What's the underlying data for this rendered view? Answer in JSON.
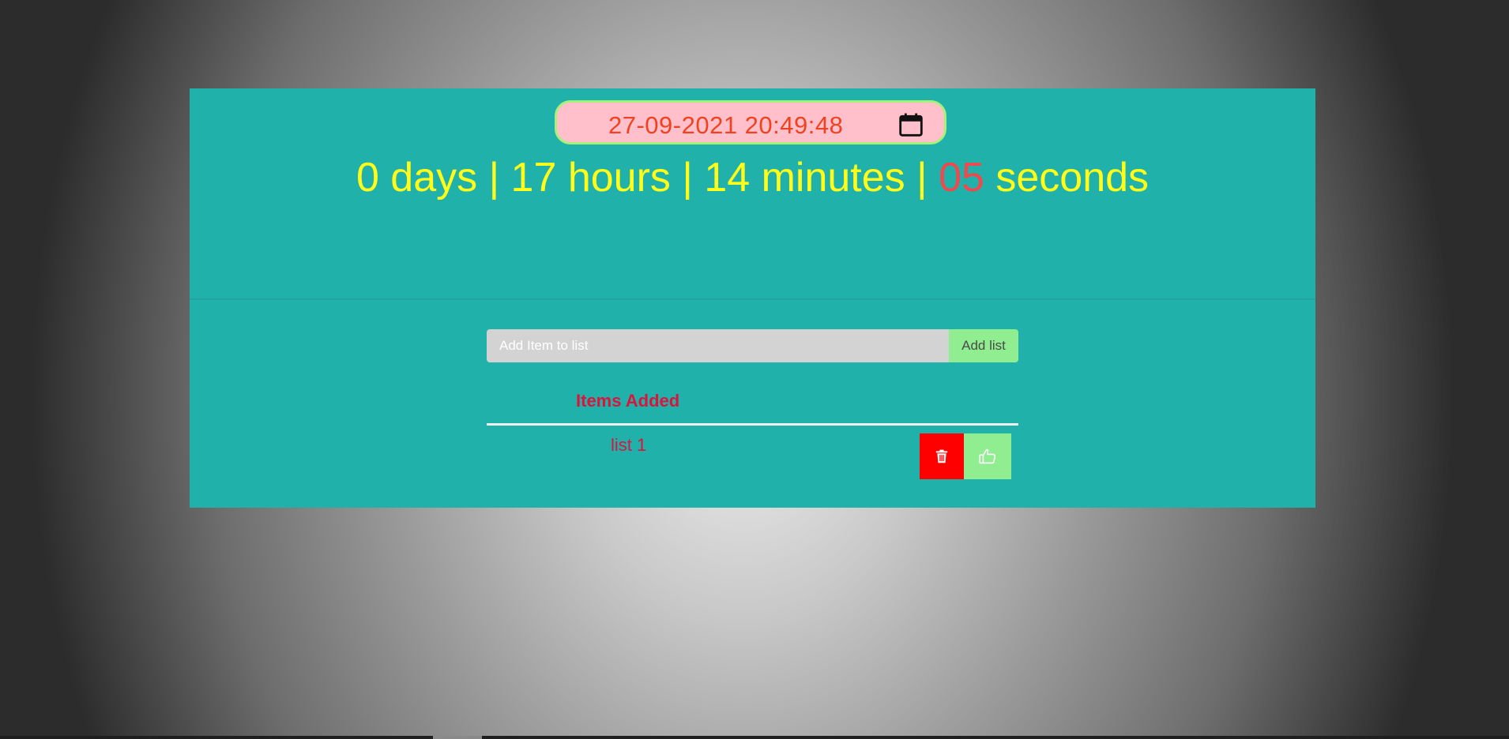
{
  "timer": {
    "datetime_value": "27-09-2021 20:49:48",
    "calendar_icon": "calendar-icon",
    "countdown": {
      "days_part": "0 days | 17 hours | 14 minutes | ",
      "seconds_number": "05",
      "seconds_unit": " seconds"
    }
  },
  "todo": {
    "input_placeholder": "Add Item to list",
    "input_value": "",
    "add_button_label": "Add list",
    "header_label": "Items Added",
    "items": [
      {
        "label": "list 1",
        "delete_icon": "trash-icon",
        "like_icon": "thumbs-up-icon"
      }
    ]
  },
  "colors": {
    "panel": "#20b2aa",
    "date_pill": "#ffc0cb",
    "date_text": "#f1421f",
    "countdown_text": "#ffff1a",
    "seconds_accent": "#f0484c",
    "list_text": "#dc143c",
    "add_button": "#90ee90",
    "delete_button": "#ff0000",
    "like_button": "#90ee90"
  }
}
